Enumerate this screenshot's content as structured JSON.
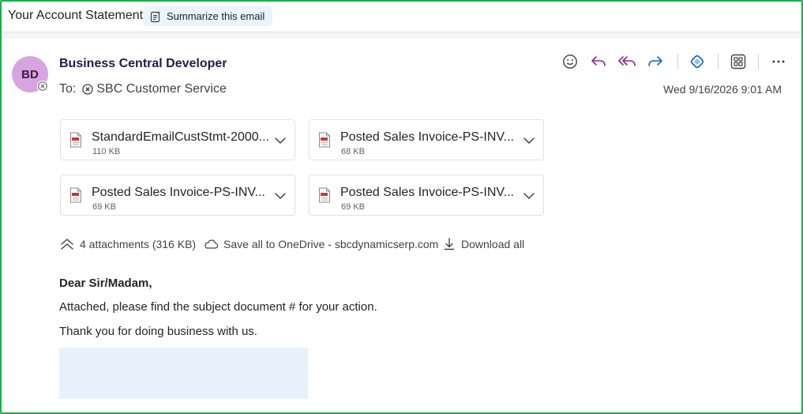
{
  "header": {
    "subject": "Your Account Statement",
    "summarize_label": "Summarize this email"
  },
  "message": {
    "avatar_initials": "BD",
    "sender": "Business Central Developer",
    "to_label": "To:",
    "recipient": "SBC Customer Service",
    "date": "Wed 9/16/2026 9:01 AM"
  },
  "actions": [
    {
      "name": "emoji-react-icon"
    },
    {
      "name": "reply-icon"
    },
    {
      "name": "reply-all-icon"
    },
    {
      "name": "forward-icon"
    },
    {
      "name": "loop-icon"
    },
    {
      "name": "apps-icon"
    },
    {
      "name": "more-options-icon"
    }
  ],
  "attachments": [
    {
      "name": "StandardEmailCustStmt-2000...",
      "size": "110 KB"
    },
    {
      "name": "Posted Sales Invoice-PS-INV...",
      "size": "68 KB"
    },
    {
      "name": "Posted Sales Invoice-PS-INV...",
      "size": "69 KB"
    },
    {
      "name": "Posted Sales Invoice-PS-INV...",
      "size": "69 KB"
    }
  ],
  "attachment_bar": {
    "count_label": "4 attachments (316 KB)",
    "save_label": "Save all to OneDrive - sbcdynamicserp.com",
    "download_label": "Download all"
  },
  "body": {
    "greeting": "Dear Sir/Madam,",
    "line1": "Attached, please find the subject document # for your action.",
    "line2": "Thank you for doing business with us."
  },
  "colors": {
    "frame": "#18b14a",
    "avatar_bg": "#d8a4df",
    "reply_accent": "#8a2a8c",
    "forward_accent": "#0f6cbd"
  }
}
